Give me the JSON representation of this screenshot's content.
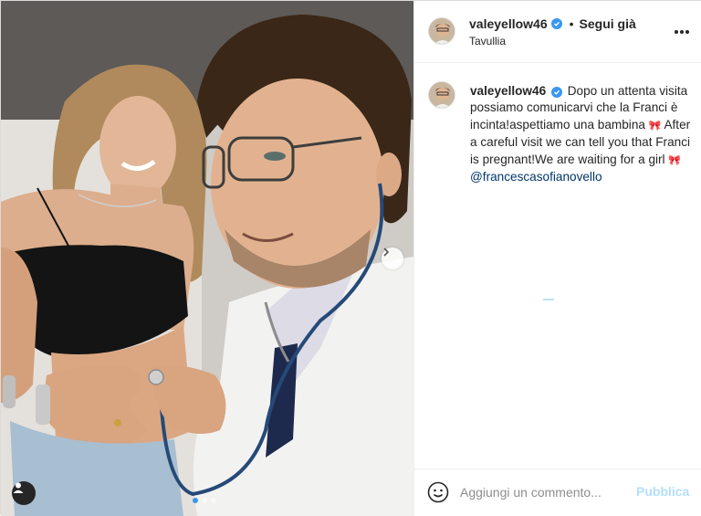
{
  "post": {
    "username": "valeyellow46",
    "follow_status": "Segui già",
    "separator": "•",
    "location": "Tavullia",
    "caption": {
      "username": "valeyellow46",
      "text_it": "Dopo un attenta visita possiamo comunicarvi che la Franci è incinta!aspettiamo una bambina",
      "text_en": "After a careful visit we can tell you that Franci is pregnant!We are waiting for a girl",
      "bow_emoji": "🎀",
      "mention": "@francescasofianovello"
    }
  },
  "media": {
    "slide_count": 3,
    "active_slide": 1
  },
  "comment": {
    "placeholder": "Aggiungi un commento...",
    "publish_label": "Pubblica"
  },
  "colors": {
    "verified": "#3897f0",
    "mention": "#00376b",
    "publish_disabled": "#b2dffc",
    "text": "#262626",
    "border": "#efefef"
  },
  "icons": {
    "verified": "verified-badge-icon",
    "more": "more-options-icon",
    "next": "chevron-right-icon",
    "tagged": "user-tag-icon",
    "emoji": "emoji-icon"
  }
}
